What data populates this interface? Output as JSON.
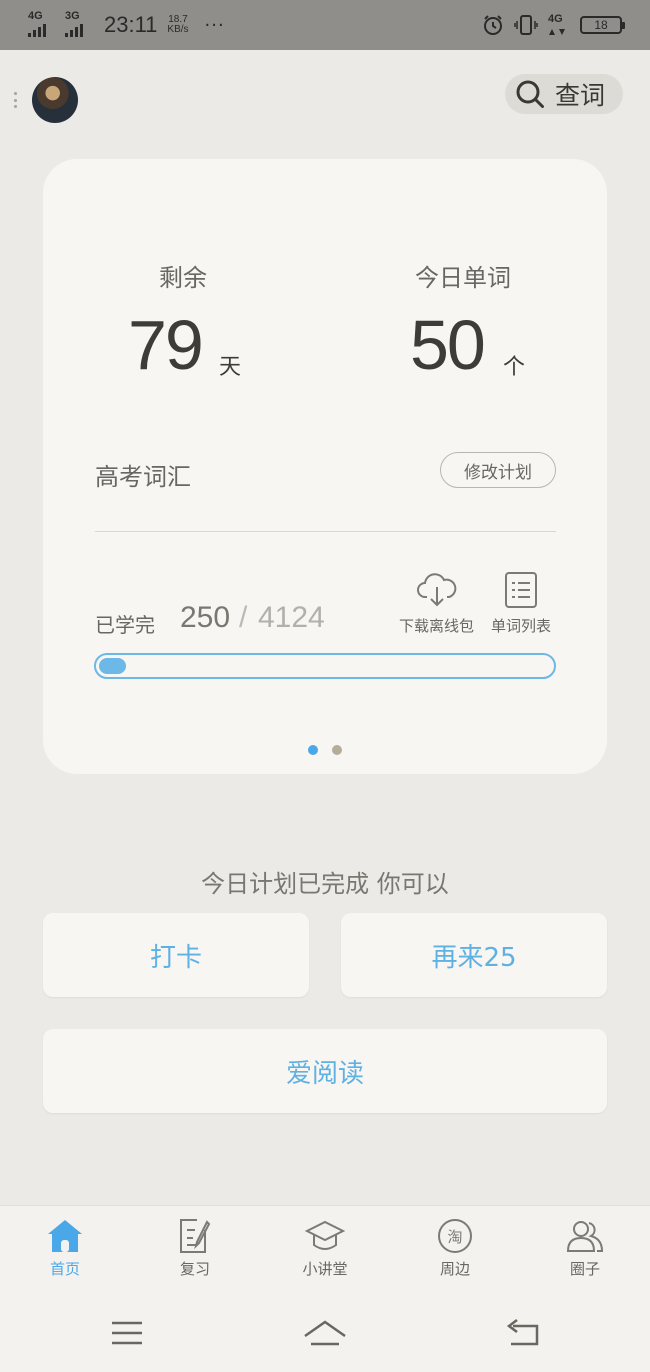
{
  "status_bar": {
    "signal1": "4G",
    "signal2": "3G",
    "time": "23:11",
    "speed_value": "18.7",
    "speed_unit": "KB/s",
    "more": "···",
    "net": "4G",
    "battery": "18"
  },
  "header": {
    "lookup_label": "查词"
  },
  "card": {
    "remaining_label": "剩余",
    "remaining_value": "79",
    "remaining_unit": "天",
    "today_label": "今日单词",
    "today_value": "50",
    "today_unit": "个",
    "book_name": "高考词汇",
    "edit_plan": "修改计划",
    "learned_label": "已学完",
    "learned_count": "250",
    "separator": "/",
    "total_count": "4124",
    "progress_fraction": 0.0606,
    "download_label": "下载离线包",
    "wordlist_label": "单词列表",
    "page_count": 2,
    "active_page": 0
  },
  "plan_done": {
    "message": "今日计划已完成 你可以",
    "checkin": "打卡",
    "again": "再来25",
    "read": "爱阅读"
  },
  "tabs": [
    {
      "label": "首页",
      "icon": "home-icon",
      "active": true
    },
    {
      "label": "复习",
      "icon": "review-icon",
      "active": false
    },
    {
      "label": "小讲堂",
      "icon": "graduation-cap-icon",
      "active": false
    },
    {
      "label": "周边",
      "icon": "taobao-icon",
      "active": false
    },
    {
      "label": "圈子",
      "icon": "people-icon",
      "active": false
    }
  ],
  "colors": {
    "accent": "#4aa8e8",
    "button_text": "#5fb1e3",
    "background": "#eceae7",
    "card": "#f7f6f3"
  }
}
